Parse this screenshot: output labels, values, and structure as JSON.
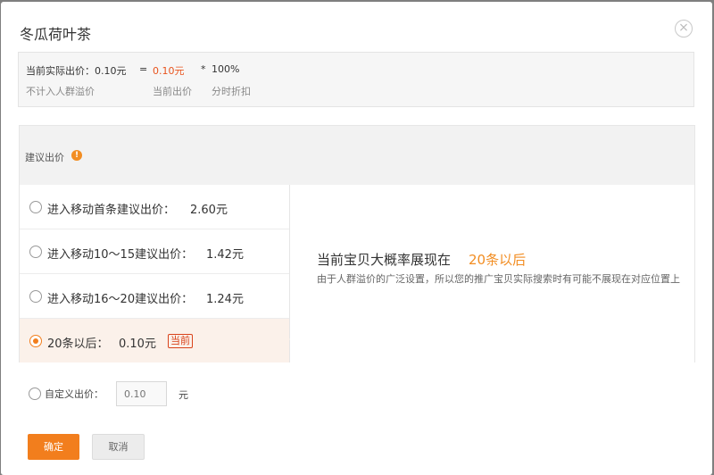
{
  "dialog": {
    "title": "冬瓜荷叶茶",
    "close_glyph": "⨯"
  },
  "summary": {
    "actual_label": "当前实际出价：0.10元",
    "equals": "=",
    "current_value": "0.10元",
    "times": "*",
    "discount": "100%",
    "note_exclude": "不计入人群溢价",
    "note_current": "当前出价",
    "note_discount": "分时折扣"
  },
  "suggest": {
    "label": "建议出价",
    "info_glyph": "!"
  },
  "options": [
    {
      "label": "进入移动首条建议出价：",
      "value": "2.60元",
      "selected": false
    },
    {
      "label": "进入移动10～15建议出价：",
      "value": "1.42元",
      "selected": false
    },
    {
      "label": "进入移动16～20建议出价：",
      "value": "1.24元",
      "selected": false
    },
    {
      "label": "20条以后：",
      "value": "0.10元",
      "selected": true,
      "badge": "当前"
    }
  ],
  "detail": {
    "headline": "当前宝贝大概率展现在",
    "headline_emphasis": "20条以后",
    "note": "由于人群溢价的广泛设置，所以您的推广宝贝实际搜索时有可能不展现在对应位置上"
  },
  "custom": {
    "label": "自定义出价：",
    "input_placeholder": "0.10",
    "unit": "元"
  },
  "buttons": {
    "ok": "确定",
    "cancel": "取消"
  },
  "colors": {
    "accent": "#f27e1d",
    "warning": "#e8541e",
    "emphasis": "#f28d22"
  }
}
